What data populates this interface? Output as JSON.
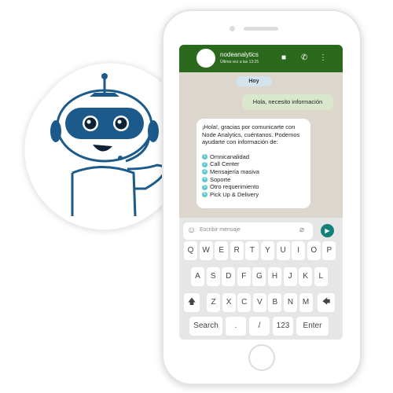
{
  "colors": {
    "header": "#2b6a1c",
    "robot": "#1b5a8a",
    "send": "#14807a",
    "list_badge": "#5cc7cf"
  },
  "header": {
    "name": "nodeanalytics",
    "status": "Última vez a las 13:25",
    "icons": [
      "video-icon",
      "phone-icon",
      "more-vert-icon"
    ]
  },
  "chat": {
    "date": "Hoy",
    "outgoing": "Hola, necesito información",
    "incoming": {
      "intro": "¡Hola!, gracias por comunicarte con Node Analytics, cuéntanos. Podemos ayudarte con información de:",
      "options": [
        {
          "n": "1",
          "label": "Omnicanalidad"
        },
        {
          "n": "2",
          "label": "Call Center"
        },
        {
          "n": "3",
          "label": "Mensajería masiva"
        },
        {
          "n": "4",
          "label": "Soporte"
        },
        {
          "n": "5",
          "label": "Otro requerimiento"
        },
        {
          "n": "6",
          "label": "Pick Up & Delivery"
        }
      ]
    }
  },
  "input": {
    "placeholder": "Escribir mensaje"
  },
  "keyboard": {
    "row1": [
      "Q",
      "W",
      "E",
      "R",
      "T",
      "Y",
      "U",
      "I",
      "O",
      "P"
    ],
    "row2": [
      "A",
      "S",
      "D",
      "F",
      "G",
      "H",
      "J",
      "K",
      "L"
    ],
    "row3": [
      "Z",
      "X",
      "C",
      "V",
      "B",
      "N",
      "M"
    ],
    "shift": "🡅",
    "backspace": "🡄",
    "search": "Search",
    "dot": ".",
    "slash": "/",
    "num": "123",
    "enter": "Enter"
  }
}
